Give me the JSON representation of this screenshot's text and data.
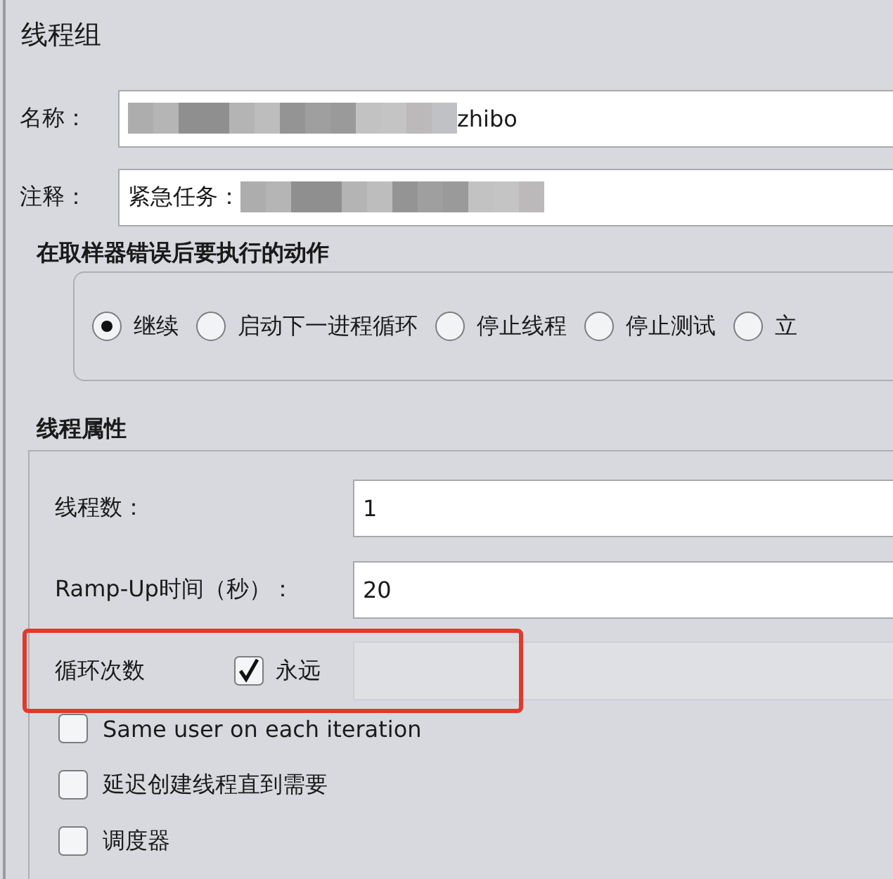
{
  "title": "线程组",
  "name": {
    "label": "名称：",
    "value": "zhibo"
  },
  "comment": {
    "label": "注释：",
    "value": "紧急任务："
  },
  "error_action": {
    "title": "在取样器错误后要执行的动作",
    "options": [
      {
        "label": "继续",
        "selected": true
      },
      {
        "label": "启动下一进程循环",
        "selected": false
      },
      {
        "label": "停止线程",
        "selected": false
      },
      {
        "label": "停止测试",
        "selected": false
      },
      {
        "label": "立",
        "selected": false
      }
    ]
  },
  "thread_properties": {
    "title": "线程属性",
    "threads": {
      "label": "线程数：",
      "value": "1"
    },
    "ramp_up": {
      "label": "Ramp-Up时间（秒）：",
      "value": "20"
    },
    "loop": {
      "label": "循环次数",
      "highlighted": true,
      "forever": {
        "label": "永远",
        "checked": true
      }
    },
    "options": [
      {
        "label": "Same user on each iteration",
        "checked": false
      },
      {
        "label": "延迟创建线程直到需要",
        "checked": false
      },
      {
        "label": "调度器",
        "checked": false
      }
    ]
  }
}
